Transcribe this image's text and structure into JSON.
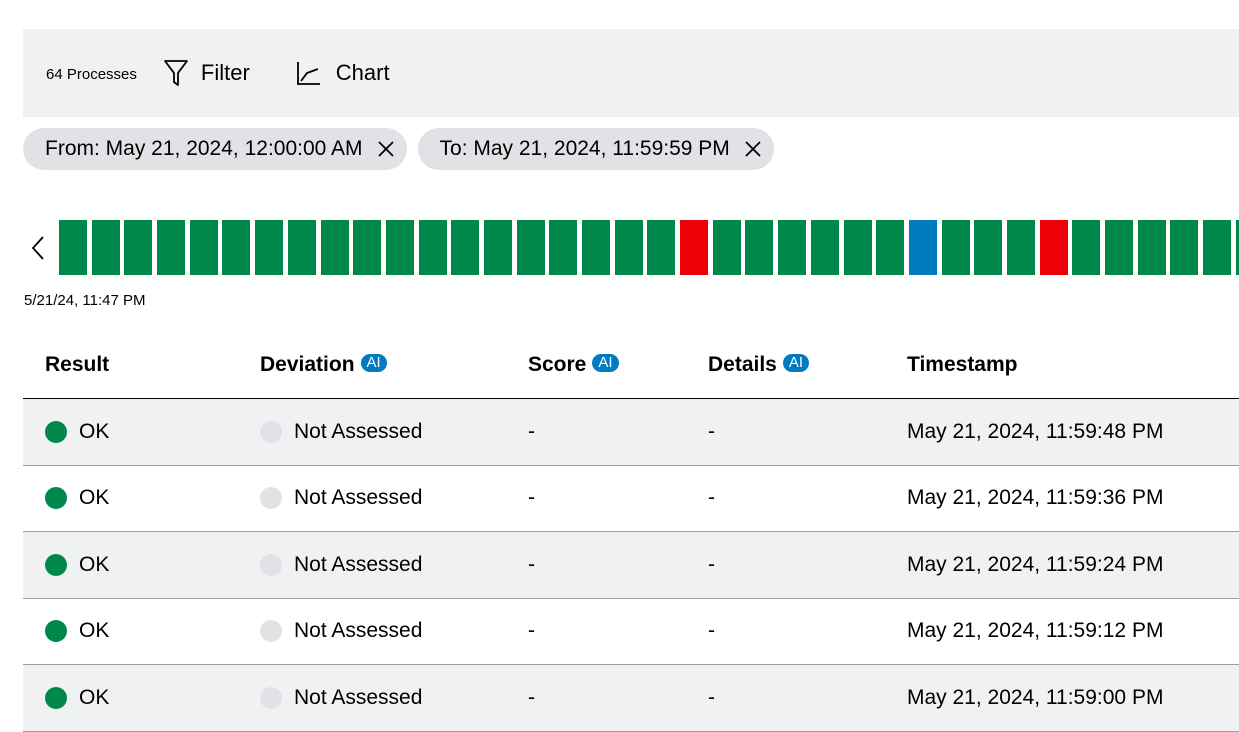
{
  "toolbar": {
    "process_count": "64 Processes",
    "filter_label": "Filter",
    "chart_label": "Chart"
  },
  "chips": [
    {
      "label": "From: May 21, 2024, 12:00:00 AM"
    },
    {
      "label": "To: May 21, 2024, 11:59:59 PM"
    }
  ],
  "timeline": {
    "date_label": "5/21/24, 11:47 PM",
    "bars": [
      "ok",
      "ok",
      "ok",
      "ok",
      "ok",
      "ok",
      "ok",
      "ok",
      "ok",
      "ok",
      "ok",
      "ok",
      "ok",
      "ok",
      "ok",
      "ok",
      "ok",
      "ok",
      "ok",
      "nok",
      "ok",
      "ok",
      "ok",
      "ok",
      "ok",
      "ok",
      "info",
      "ok",
      "ok",
      "ok",
      "nok",
      "ok",
      "ok",
      "ok",
      "ok",
      "ok",
      "ok"
    ]
  },
  "colors": {
    "ok": "#00884a",
    "nok": "#ed0007",
    "info": "#007bc0",
    "not_assessed": "#e0e2e5"
  },
  "table": {
    "headers": {
      "result": "Result",
      "deviation": "Deviation",
      "score": "Score",
      "details": "Details",
      "timestamp": "Timestamp",
      "ai_badge": "AI"
    },
    "rows": [
      {
        "result": "OK",
        "deviation": "Not Assessed",
        "score": "-",
        "details": "-",
        "timestamp": "May 21, 2024, 11:59:48 PM"
      },
      {
        "result": "OK",
        "deviation": "Not Assessed",
        "score": "-",
        "details": "-",
        "timestamp": "May 21, 2024, 11:59:36 PM"
      },
      {
        "result": "OK",
        "deviation": "Not Assessed",
        "score": "-",
        "details": "-",
        "timestamp": "May 21, 2024, 11:59:24 PM"
      },
      {
        "result": "OK",
        "deviation": "Not Assessed",
        "score": "-",
        "details": "-",
        "timestamp": "May 21, 2024, 11:59:12 PM"
      },
      {
        "result": "OK",
        "deviation": "Not Assessed",
        "score": "-",
        "details": "-",
        "timestamp": "May 21, 2024, 11:59:00 PM"
      }
    ]
  }
}
